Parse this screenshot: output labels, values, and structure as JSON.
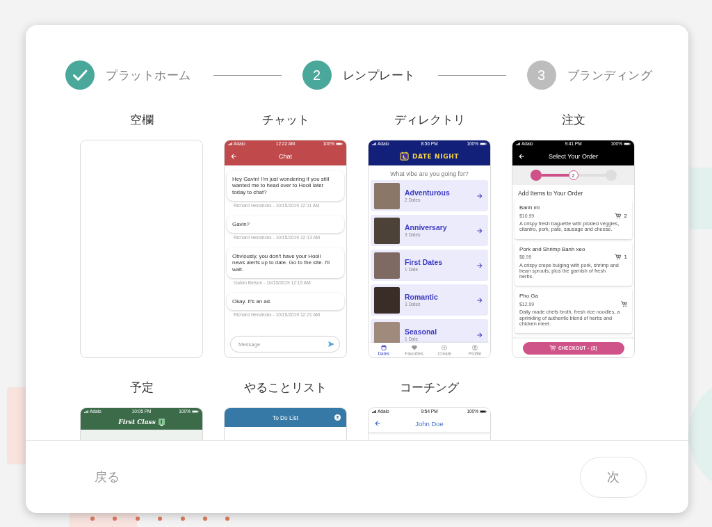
{
  "stepper": {
    "steps": [
      {
        "label": "プラットホーム",
        "completed": true,
        "selected": false
      },
      {
        "number": "2",
        "label": "レンプレート",
        "completed": false,
        "selected": true
      },
      {
        "number": "3",
        "label": "ブランディング",
        "completed": false,
        "selected": false
      }
    ]
  },
  "templates": [
    {
      "title": "空欄",
      "kind": "blank"
    },
    {
      "title": "チャット",
      "kind": "chat",
      "status_bar": {
        "carrier": "Adalo",
        "time": "12:22 AM",
        "battery": "100%"
      },
      "header": {
        "title": "Chat"
      },
      "messages": [
        {
          "text": "Hey Gavin! I'm just wondering if you still wanted me to head over to Hooli later today to chat?",
          "meta": "Richard Hendricks - 10/15/2019 12:11 AM"
        },
        {
          "text": "Gavin?",
          "meta": "Richard Hendricks - 10/15/2019 12:13 AM"
        },
        {
          "text": "Obviously, you don't have your Hooli news alerts up to date. Go to the site. I'll wait.",
          "meta": "Galvin Belson - 10/15/2019 12:15 AM"
        },
        {
          "text": "Okay. It's an ad.",
          "meta": "Richard Hendricks - 10/15/2019 12:21 AM"
        }
      ],
      "composer": {
        "placeholder": "Message"
      }
    },
    {
      "title": "ディレクトリ",
      "kind": "directory",
      "status_bar": {
        "carrier": "Adalo",
        "time": "8:56 PM",
        "battery": "100%"
      },
      "header": {
        "logo": "DATE NIGHT"
      },
      "prompt": "What vibe are you going for?",
      "items": [
        {
          "title": "Adventurous",
          "subtitle": "2 Dates"
        },
        {
          "title": "Anniversary",
          "subtitle": "3 Dates"
        },
        {
          "title": "First Dates",
          "subtitle": "1 Date"
        },
        {
          "title": "Romantic",
          "subtitle": "3 Dates"
        },
        {
          "title": "Seasonal",
          "subtitle": "1 Date"
        }
      ],
      "tab_bar": [
        {
          "label": "Dates",
          "selected": true
        },
        {
          "label": "Favorites",
          "selected": false
        },
        {
          "label": "Create",
          "selected": false
        },
        {
          "label": "Profile",
          "selected": false
        }
      ]
    },
    {
      "title": "注文",
      "kind": "order",
      "status_bar": {
        "carrier": "Adalo",
        "time": "9:41 PM",
        "battery": "100%"
      },
      "header": {
        "title": "Select Your Order"
      },
      "progress_steps": [
        {
          "completed": true,
          "selected": false
        },
        {
          "number": "2",
          "completed": false,
          "selected": true
        },
        {
          "completed": false,
          "selected": false
        }
      ],
      "section_title": "Add Items to Your Order",
      "items": [
        {
          "name": "Banh mi",
          "price": "$10.99",
          "quantity": "2",
          "description": "A crispy fresh baguette with pickled veggies, cilantro, pork, pate, sausage and cheese."
        },
        {
          "name": "Pork and Shrimp Banh xeo",
          "price": "$8.99",
          "quantity": "1",
          "description": "A crispy crepe bulging with pork, shrimp and bean sprouts, plus the garnish of fresh herbs."
        },
        {
          "name": "Pho Ga",
          "price": "$12.99",
          "description": "Daily made chefs broth, fresh rice noodles, a sprinkling of authentic blend of herbs and chicken meet."
        }
      ],
      "checkout": "CHECKOUT - (3)"
    },
    {
      "title": "予定",
      "kind": "schedule",
      "status_bar": {
        "carrier": "Adalo",
        "time": "10:05 PM",
        "battery": "100%"
      },
      "header": {
        "logo": "First Class"
      }
    },
    {
      "title": "やることリスト",
      "kind": "todo",
      "header": {
        "title": "To Do List"
      }
    },
    {
      "title": "コーチング",
      "kind": "coaching",
      "status_bar": {
        "carrier": "Adalo",
        "time": "9:54 PM",
        "battery": "100%"
      },
      "header": {
        "title": "John Doe"
      }
    }
  ],
  "footer": {
    "back": "戻る",
    "next": {
      "label": "次",
      "disabled": true
    }
  }
}
